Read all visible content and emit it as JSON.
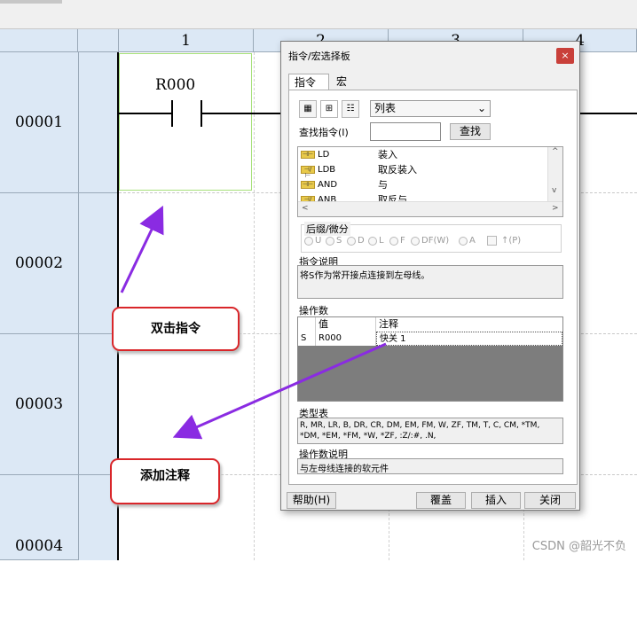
{
  "columns": [
    "1",
    "2",
    "3",
    "4"
  ],
  "rows": [
    "00001",
    "00002",
    "00003",
    "00004"
  ],
  "contact_label": "R000",
  "callouts": {
    "double_click": "双击指令",
    "add_comment": "添加注释"
  },
  "watermark": "CSDN @韶光不负",
  "colors": {
    "arrow": "#8a2be2",
    "callout_border": "#d9262a",
    "selection": "#a6e07a",
    "header_bg": "#dce8f5"
  },
  "dialog": {
    "title": "指令/宏选择板",
    "close_label": "×",
    "tabs": [
      "指令",
      "宏"
    ],
    "view_select": "列表",
    "find_label": "查找指令(I)",
    "find_value": "",
    "find_button": "查找",
    "instructions": [
      {
        "cmd": "LD",
        "desc": "装入",
        "icon": "contact-no-icon"
      },
      {
        "cmd": "LDB",
        "desc": "取反装入",
        "icon": "contact-nc-icon"
      },
      {
        "cmd": "AND",
        "desc": "与",
        "icon": "contact-no-icon"
      },
      {
        "cmd": "ANB",
        "desc": "取反与",
        "icon": "contact-nc-icon"
      }
    ],
    "suffix_label": "后缀/微分",
    "suffix_options": [
      "U",
      "S",
      "D",
      "L",
      "F",
      "DF(W)",
      "A",
      "↑(P)"
    ],
    "desc_label": "指令说明",
    "desc_text": "将S作为常开接点连接到左母线。",
    "operand_count_label": "操作数",
    "operand_headers": [
      "",
      "值",
      "注释"
    ],
    "operand_row": {
      "name": "S",
      "value": "R000",
      "comment": "快关 1"
    },
    "type_table_label": "类型表",
    "type_table_text": "R, MR, LR, B, DR, CR, DM, EM, FM, W, ZF, TM, T, C, CM, *TM, *DM, *EM, *FM, *W, *ZF, :Z/:#, .N,",
    "operand_desc_label": "操作数说明",
    "operand_desc_text": "与左母线连接的软元件",
    "buttons": {
      "help": "帮助(H)",
      "overwrite": "覆盖",
      "insert": "插入",
      "close": "关闭"
    }
  }
}
